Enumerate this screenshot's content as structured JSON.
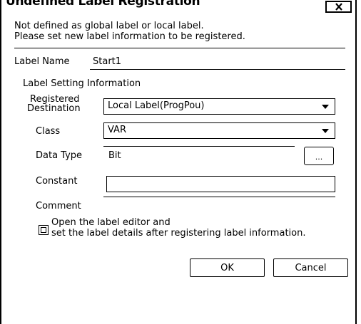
{
  "dialog": {
    "title": "Undefined Label Registration",
    "close_label": "x"
  },
  "message": {
    "line1": "Not defined as global label or local label.",
    "line2": "Please set new label information to be registered."
  },
  "label_name": {
    "caption": "Label Name",
    "value": "Start1"
  },
  "setting": {
    "group_caption": "Label Setting Information",
    "registered_destination": {
      "caption_line1": "Registered",
      "caption_line2": "Destination",
      "value": "Local Label(ProgPou)"
    },
    "class": {
      "caption": "Class",
      "value": "VAR"
    },
    "data_type": {
      "caption": "Data Type",
      "value": "Bit",
      "browse_label": "..."
    },
    "constant": {
      "caption": "Constant",
      "value": ""
    },
    "comment": {
      "caption": "Comment",
      "value": ""
    }
  },
  "open_editor": {
    "line1": "Open the label editor and",
    "line2": "set the label details after registering label information.",
    "checked": false
  },
  "buttons": {
    "ok": "OK",
    "cancel": "Cancel"
  }
}
